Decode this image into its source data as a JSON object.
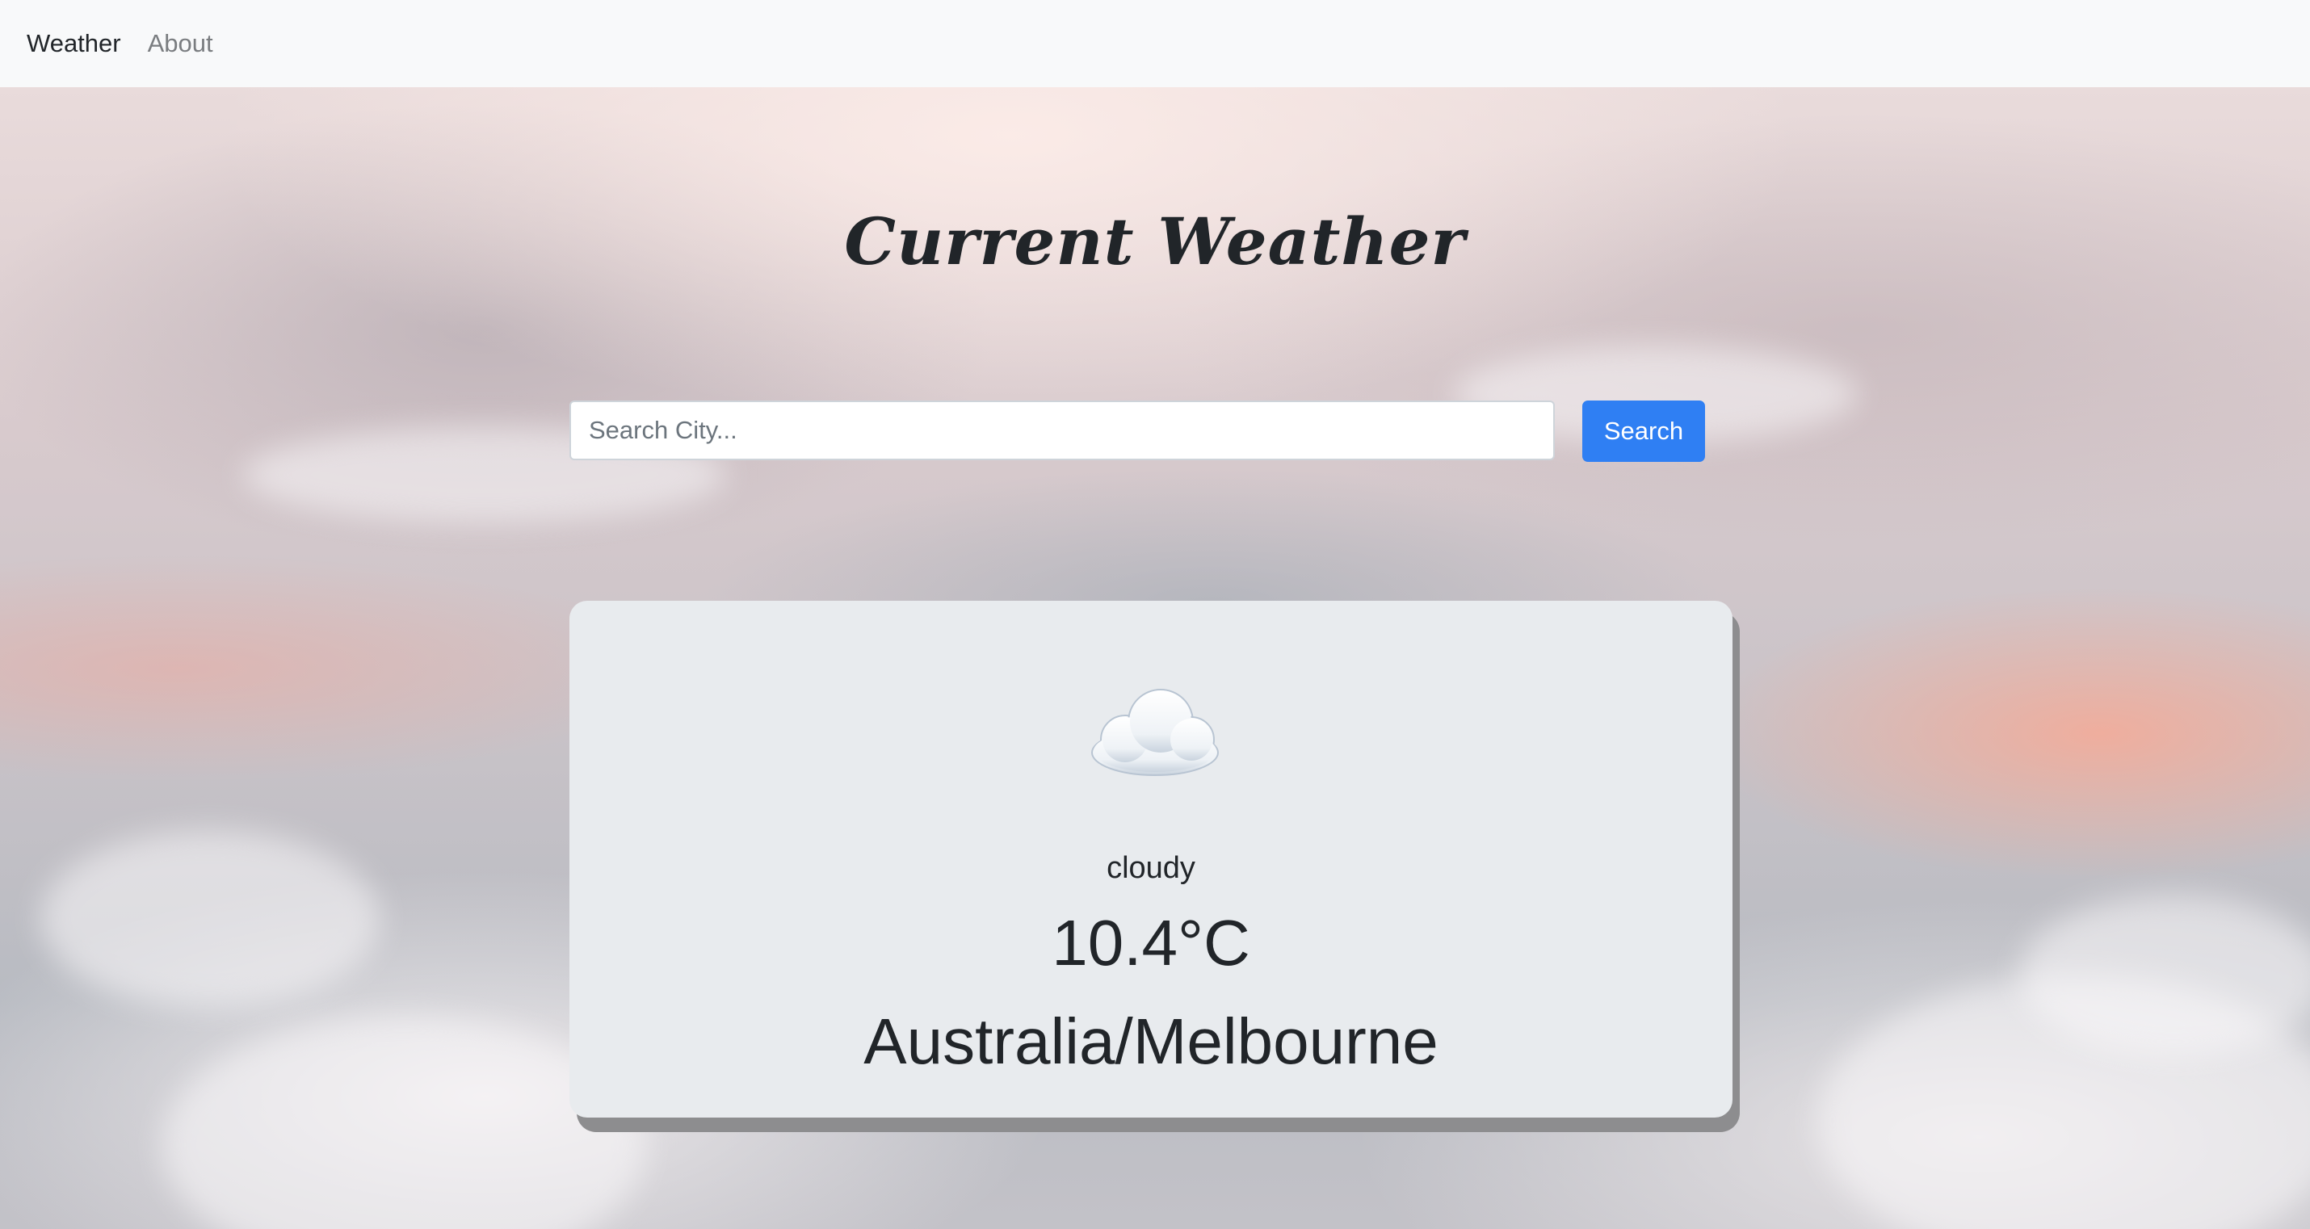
{
  "nav": {
    "items": [
      {
        "label": "Weather",
        "active": true
      },
      {
        "label": "About",
        "active": false
      }
    ]
  },
  "header": {
    "title": "Current Weather"
  },
  "search": {
    "placeholder": "Search City...",
    "value": "",
    "button_label": "Search"
  },
  "weather": {
    "icon": "cloud-icon",
    "condition": "cloudy",
    "temperature": "10.4°C",
    "location": "Australia/Melbourne"
  },
  "colors": {
    "navbar_bg": "#f8f9fa",
    "button_bg": "#2f7ff3",
    "card_bg": "#e8ebee",
    "card_shadow": "#8d8d8f"
  }
}
